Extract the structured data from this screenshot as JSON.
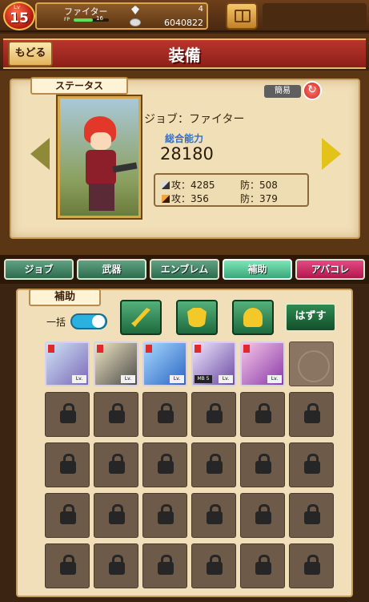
{
  "player": {
    "level_tag": "Lv",
    "level": "15",
    "job": "ファイター",
    "fp_label": "FP",
    "fp_value": "16",
    "fp_fraction": 0.55,
    "crystals": "4",
    "gold": "6040822"
  },
  "header": {
    "back_label": "もどる",
    "title": "装備"
  },
  "status": {
    "tag": "ステータス",
    "simple_label": "簡易",
    "job_line": "ジョブ：ファイター",
    "power_label": "総合能力",
    "power_value": "28180",
    "phys_line": "攻：4285",
    "phys_def": "防：508",
    "mag_line": "攻：356",
    "mag_def": "防：379"
  },
  "tabs": [
    {
      "label": "ジョブ"
    },
    {
      "label": "武器"
    },
    {
      "label": "エンブレム"
    },
    {
      "label": "補助"
    },
    {
      "label": "アバコレ"
    }
  ],
  "support": {
    "tag": "補助",
    "bulk_label": "一括",
    "remove_label": "はずす",
    "card_level": "Lv.",
    "mb_label": "MB 5",
    "filter_icons": [
      "sword-icon",
      "armor-icon",
      "helmet-icon"
    ]
  },
  "colors": {
    "tab_active": "#3aa87a",
    "tab_pink": "#b3174c",
    "power_label": "#2e6fd6"
  }
}
